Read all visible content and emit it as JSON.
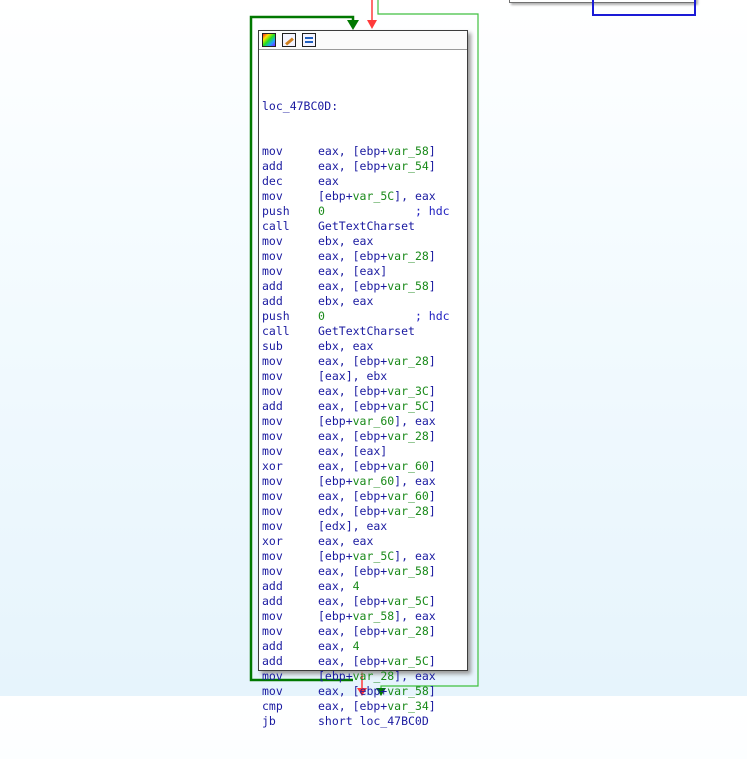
{
  "graph": {
    "edges": [
      {
        "name": "edge-incoming-red",
        "color": "#ff3a3a"
      },
      {
        "name": "edge-incoming-light-green",
        "color": "#40c040"
      },
      {
        "name": "edge-loop-green",
        "color": "#007800"
      },
      {
        "name": "edge-outgoing-red",
        "color": "#ff3a3a"
      },
      {
        "name": "edge-outgoing-green",
        "color": "#007800"
      }
    ]
  },
  "node": {
    "header_icons": [
      "color-palette-icon",
      "edit-node-icon",
      "graph-overview-icon"
    ],
    "label": "loc_47BC0D:",
    "lines": [
      {
        "mn": "mov",
        "parts": [
          [
            "op",
            "eax, [ebp+"
          ],
          [
            "var",
            "var_58"
          ],
          [
            "op",
            "]"
          ]
        ]
      },
      {
        "mn": "add",
        "parts": [
          [
            "op",
            "eax, [ebp+"
          ],
          [
            "var",
            "var_54"
          ],
          [
            "op",
            "]"
          ]
        ]
      },
      {
        "mn": "dec",
        "parts": [
          [
            "op",
            "eax"
          ]
        ]
      },
      {
        "mn": "mov",
        "parts": [
          [
            "op",
            "[ebp+"
          ],
          [
            "var",
            "var_5C"
          ],
          [
            "op",
            "], eax"
          ]
        ]
      },
      {
        "mn": "push",
        "parts": [
          [
            "num",
            "0"
          ],
          [
            "op",
            "             "
          ],
          [
            "cmt",
            "; hdc"
          ]
        ]
      },
      {
        "mn": "call",
        "parts": [
          [
            "fn",
            "GetTextCharset"
          ]
        ]
      },
      {
        "mn": "mov",
        "parts": [
          [
            "op",
            "ebx, eax"
          ]
        ]
      },
      {
        "mn": "mov",
        "parts": [
          [
            "op",
            "eax, [ebp+"
          ],
          [
            "var",
            "var_28"
          ],
          [
            "op",
            "]"
          ]
        ]
      },
      {
        "mn": "mov",
        "parts": [
          [
            "op",
            "eax, [eax]"
          ]
        ]
      },
      {
        "mn": "add",
        "parts": [
          [
            "op",
            "eax, [ebp+"
          ],
          [
            "var",
            "var_58"
          ],
          [
            "op",
            "]"
          ]
        ]
      },
      {
        "mn": "add",
        "parts": [
          [
            "op",
            "ebx, eax"
          ]
        ]
      },
      {
        "mn": "push",
        "parts": [
          [
            "num",
            "0"
          ],
          [
            "op",
            "             "
          ],
          [
            "cmt",
            "; hdc"
          ]
        ]
      },
      {
        "mn": "call",
        "parts": [
          [
            "fn",
            "GetTextCharset"
          ]
        ]
      },
      {
        "mn": "sub",
        "parts": [
          [
            "op",
            "ebx, eax"
          ]
        ]
      },
      {
        "mn": "mov",
        "parts": [
          [
            "op",
            "eax, [ebp+"
          ],
          [
            "var",
            "var_28"
          ],
          [
            "op",
            "]"
          ]
        ]
      },
      {
        "mn": "mov",
        "parts": [
          [
            "op",
            "[eax], ebx"
          ]
        ]
      },
      {
        "mn": "mov",
        "parts": [
          [
            "op",
            "eax, [ebp+"
          ],
          [
            "var",
            "var_3C"
          ],
          [
            "op",
            "]"
          ]
        ]
      },
      {
        "mn": "add",
        "parts": [
          [
            "op",
            "eax, [ebp+"
          ],
          [
            "var",
            "var_5C"
          ],
          [
            "op",
            "]"
          ]
        ]
      },
      {
        "mn": "mov",
        "parts": [
          [
            "op",
            "[ebp+"
          ],
          [
            "var",
            "var_60"
          ],
          [
            "op",
            "], eax"
          ]
        ]
      },
      {
        "mn": "mov",
        "parts": [
          [
            "op",
            "eax, [ebp+"
          ],
          [
            "var",
            "var_28"
          ],
          [
            "op",
            "]"
          ]
        ]
      },
      {
        "mn": "mov",
        "parts": [
          [
            "op",
            "eax, [eax]"
          ]
        ]
      },
      {
        "mn": "xor",
        "parts": [
          [
            "op",
            "eax, [ebp+"
          ],
          [
            "var",
            "var_60"
          ],
          [
            "op",
            "]"
          ]
        ]
      },
      {
        "mn": "mov",
        "parts": [
          [
            "op",
            "[ebp+"
          ],
          [
            "var",
            "var_60"
          ],
          [
            "op",
            "], eax"
          ]
        ]
      },
      {
        "mn": "mov",
        "parts": [
          [
            "op",
            "eax, [ebp+"
          ],
          [
            "var",
            "var_60"
          ],
          [
            "op",
            "]"
          ]
        ]
      },
      {
        "mn": "mov",
        "parts": [
          [
            "op",
            "edx, [ebp+"
          ],
          [
            "var",
            "var_28"
          ],
          [
            "op",
            "]"
          ]
        ]
      },
      {
        "mn": "mov",
        "parts": [
          [
            "op",
            "[edx], eax"
          ]
        ]
      },
      {
        "mn": "xor",
        "parts": [
          [
            "op",
            "eax, eax"
          ]
        ]
      },
      {
        "mn": "mov",
        "parts": [
          [
            "op",
            "[ebp+"
          ],
          [
            "var",
            "var_5C"
          ],
          [
            "op",
            "], eax"
          ]
        ]
      },
      {
        "mn": "mov",
        "parts": [
          [
            "op",
            "eax, [ebp+"
          ],
          [
            "var",
            "var_58"
          ],
          [
            "op",
            "]"
          ]
        ]
      },
      {
        "mn": "add",
        "parts": [
          [
            "op",
            "eax, "
          ],
          [
            "num",
            "4"
          ]
        ]
      },
      {
        "mn": "add",
        "parts": [
          [
            "op",
            "eax, [ebp+"
          ],
          [
            "var",
            "var_5C"
          ],
          [
            "op",
            "]"
          ]
        ]
      },
      {
        "mn": "mov",
        "parts": [
          [
            "op",
            "[ebp+"
          ],
          [
            "var",
            "var_58"
          ],
          [
            "op",
            "], eax"
          ]
        ]
      },
      {
        "mn": "mov",
        "parts": [
          [
            "op",
            "eax, [ebp+"
          ],
          [
            "var",
            "var_28"
          ],
          [
            "op",
            "]"
          ]
        ]
      },
      {
        "mn": "add",
        "parts": [
          [
            "op",
            "eax, "
          ],
          [
            "num",
            "4"
          ]
        ]
      },
      {
        "mn": "add",
        "parts": [
          [
            "op",
            "eax, [ebp+"
          ],
          [
            "var",
            "var_5C"
          ],
          [
            "op",
            "]"
          ]
        ]
      },
      {
        "mn": "mov",
        "parts": [
          [
            "op",
            "[ebp+"
          ],
          [
            "var",
            "var_28"
          ],
          [
            "op",
            "], eax"
          ]
        ]
      },
      {
        "mn": "mov",
        "parts": [
          [
            "op",
            "eax, [ebp+"
          ],
          [
            "var",
            "var_58"
          ],
          [
            "op",
            "]"
          ]
        ]
      },
      {
        "mn": "cmp",
        "parts": [
          [
            "op",
            "eax, [ebp+"
          ],
          [
            "var",
            "var_34"
          ],
          [
            "op",
            "]"
          ]
        ]
      },
      {
        "mn": "jb",
        "parts": [
          [
            "op",
            "short loc_47BC0D"
          ]
        ]
      }
    ]
  }
}
